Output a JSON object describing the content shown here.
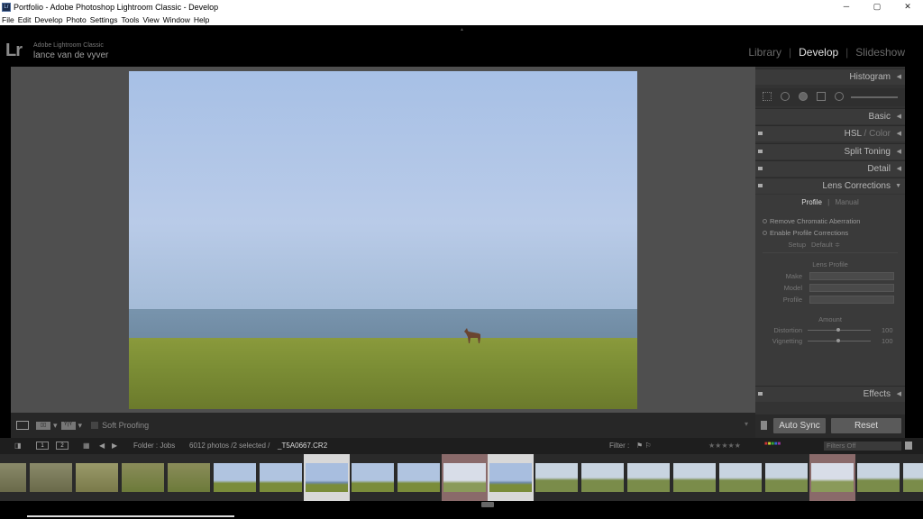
{
  "window": {
    "title": "Portfolio - Adobe Photoshop Lightroom Classic - Develop",
    "app_icon": "Lr",
    "controls": [
      "─",
      "▢",
      "✕"
    ]
  },
  "menu": [
    "File",
    "Edit",
    "Develop",
    "Photo",
    "Settings",
    "Tools",
    "View",
    "Window",
    "Help"
  ],
  "identity": {
    "logo": "Lr",
    "product": "Adobe Lightroom Classic",
    "user": "lance van de vyver"
  },
  "modules": {
    "library": "Library",
    "develop": "Develop",
    "slideshow": "Slideshow",
    "separator": "|",
    "active": "Develop"
  },
  "toolbar": {
    "view_yy": "Y|Y",
    "soft_proofing": "Soft Proofing"
  },
  "right_panel": {
    "histogram": "Histogram",
    "basic": "Basic",
    "hsl": "HSL",
    "hsl_sep": " / ",
    "color": "Color",
    "split_toning": "Split Toning",
    "detail": "Detail",
    "lens_corrections": "Lens Corrections",
    "effects": "Effects",
    "lens": {
      "tab_profile": "Profile",
      "tab_manual": "Manual",
      "remove_ca": "Remove Chromatic Aberration",
      "enable_profile": "Enable Profile Corrections",
      "setup_label": "Setup",
      "setup_value": "Default ≑",
      "lens_profile_head": "Lens Profile",
      "make_label": "Make",
      "model_label": "Model",
      "profile_label": "Profile",
      "amount_head": "Amount",
      "distortion_label": "Distortion",
      "distortion_value": "100",
      "vignetting_label": "Vignetting",
      "vignetting_value": "100"
    },
    "auto_sync": "Auto Sync",
    "reset": "Reset"
  },
  "filmbar": {
    "page1": "1",
    "page2": "2",
    "folder": "Folder : Jobs",
    "count": "6012 photos /2 selected /",
    "filename": "_T5A0667.CR2",
    "filter_label": "Filter :",
    "filter_value": "Filters Off",
    "stars": "★★★★★"
  },
  "colors": {
    "panel_bg": "#333333",
    "accent_text": "#e0e0e0",
    "sky": "#b9cbe8",
    "grass": "#7c8e35"
  }
}
